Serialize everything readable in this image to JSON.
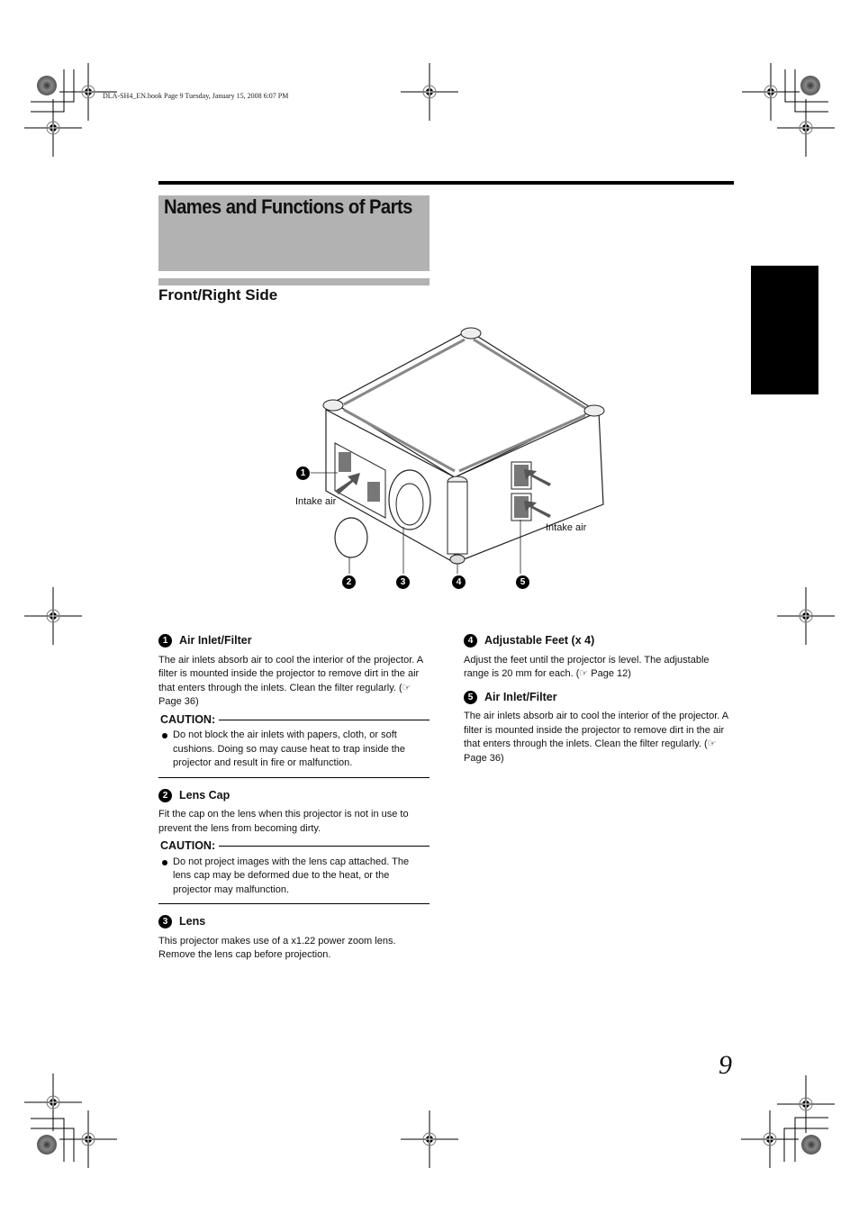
{
  "header_meta": "DLA-SH4_EN.book  Page 9  Tuesday, January 15, 2008  6:07 PM",
  "page_title": "Names and Functions of Parts",
  "section_title": "Front/Right Side",
  "page_number": "9",
  "diagram": {
    "callouts": [
      "1",
      "2",
      "3",
      "4",
      "5"
    ],
    "labels": {
      "intake_left": "Intake air",
      "intake_right": "Intake air"
    }
  },
  "items": [
    {
      "num": "1",
      "title": "Air Inlet/Filter",
      "body": "The air inlets absorb air to cool the interior of the projector. A filter is mounted inside the projector to remove dirt in the air that enters through the inlets. Clean the filter regularly. (☞ Page 36)",
      "caution_label": "CAUTION:",
      "caution": "Do not block the air inlets with papers, cloth, or soft cushions. Doing so may cause heat to trap inside the projector and result in fire or malfunction."
    },
    {
      "num": "2",
      "title": "Lens Cap",
      "body": "Fit the cap on the lens when this projector is not in use to prevent the lens from becoming dirty.",
      "caution_label": "CAUTION:",
      "caution": "Do not project images with the lens cap attached. The lens cap may be deformed due to the heat, or the projector may malfunction."
    },
    {
      "num": "3",
      "title": "Lens",
      "body": "This projector makes use of a x1.22 power zoom lens. Remove the lens cap before projection."
    },
    {
      "num": "4",
      "title": "Adjustable Feet (x 4)",
      "body": "Adjust the feet until the projector is level. The adjustable range is 20 mm for each. (☞ Page 12)"
    },
    {
      "num": "5",
      "title": "Air Inlet/Filter",
      "body": "The air inlets absorb air to cool the interior of the projector. A filter is mounted inside the projector to remove dirt in the air that enters through the inlets. Clean the filter regularly. (☞ Page 36)"
    }
  ]
}
